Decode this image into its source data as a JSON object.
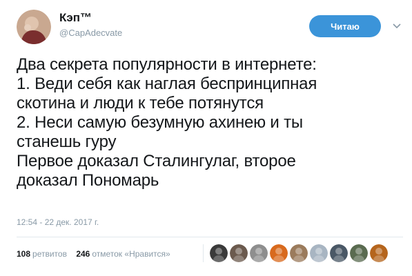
{
  "tweet": {
    "author": {
      "display_name": "Кэп™",
      "handle": "@CapAdecvate",
      "avatar_icon": "user-avatar-icon"
    },
    "follow_button_label": "Читаю",
    "caret_icon": "chevron-down-icon",
    "text_lines": [
      "Два секрета популярности в интернете:",
      "1. Веди себя как наглая беспринципная",
      "скотина и люди к тебе потянутся",
      "2. Неси самую безумную ахинею и ты",
      "станешь гуру",
      "Первое доказал Сталингулаг, второе",
      "доказал Пономарь"
    ],
    "timestamp": "12:54 - 22 дек. 2017 г.",
    "stats": {
      "retweets_count": "108",
      "retweets_label": "ретвитов",
      "likes_count": "246",
      "likes_label": "отметок «Нравится»"
    },
    "likers": [
      {
        "icon": "liker-avatar-icon",
        "color": "#3a3a3a"
      },
      {
        "icon": "liker-avatar-icon",
        "color": "#6b5a4e"
      },
      {
        "icon": "liker-avatar-icon",
        "color": "#8e8e8e"
      },
      {
        "icon": "liker-avatar-icon",
        "color": "#d86a1e"
      },
      {
        "icon": "liker-avatar-icon",
        "color": "#9b7b5c"
      },
      {
        "icon": "liker-avatar-icon",
        "color": "#a8b5c2"
      },
      {
        "icon": "liker-avatar-icon",
        "color": "#4a5866"
      },
      {
        "icon": "liker-avatar-icon",
        "color": "#5a6b50"
      },
      {
        "icon": "liker-avatar-icon",
        "color": "#b5651d"
      }
    ]
  },
  "colors": {
    "button": "#3b94d9",
    "muted_text": "#8899a6",
    "main_text": "#14171a",
    "divider": "#e1e8ed"
  }
}
